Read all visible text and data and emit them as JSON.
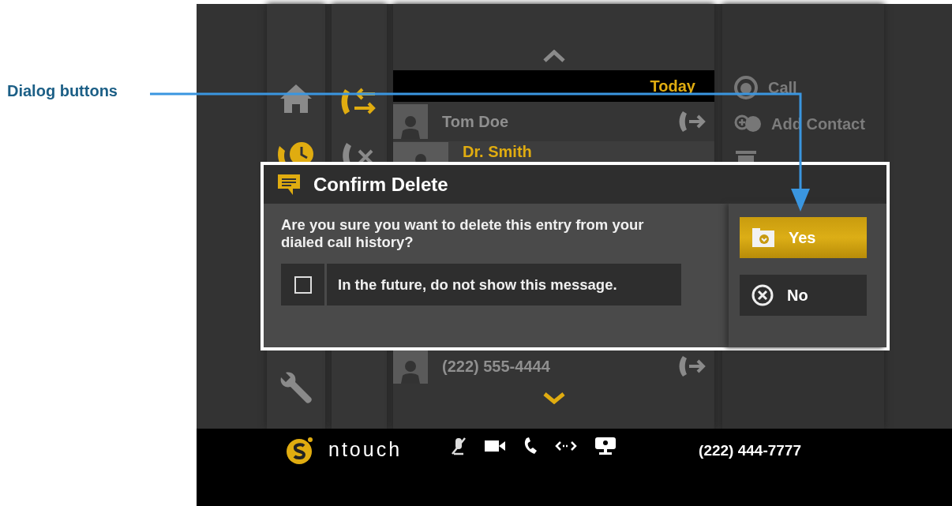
{
  "annotation": {
    "label": "Dialog buttons"
  },
  "nav": [
    {
      "kind": "home",
      "selected": false
    },
    {
      "kind": "history",
      "selected": true
    },
    {
      "kind": "settings",
      "selected": false
    }
  ],
  "subnav": [
    {
      "kind": "all-calls",
      "selected": true
    },
    {
      "kind": "missed-calls",
      "selected": false
    }
  ],
  "list": {
    "header": "Today",
    "rows": [
      {
        "name": "Tom Doe",
        "selected": false
      },
      {
        "name": "Dr. Smith",
        "selected": true
      },
      {
        "name": "(222) 555-4444",
        "selected": false
      }
    ]
  },
  "menu": [
    {
      "kind": "call",
      "label": "Call"
    },
    {
      "kind": "add-contact",
      "label": "Add Contact"
    },
    {
      "kind": "delete"
    }
  ],
  "dialog": {
    "title": "Confirm Delete",
    "message": "Are you sure you want to delete this entry from your dialed call history?",
    "checkbox": {
      "label": "In the future, do not show this message.",
      "checked": false
    },
    "buttons": [
      {
        "kind": "yes",
        "label": "Yes",
        "selected": true
      },
      {
        "kind": "no",
        "label": "No",
        "selected": false
      }
    ]
  },
  "status_bar": {
    "brand": "ntouch",
    "phone": "(222) 444-7777"
  }
}
